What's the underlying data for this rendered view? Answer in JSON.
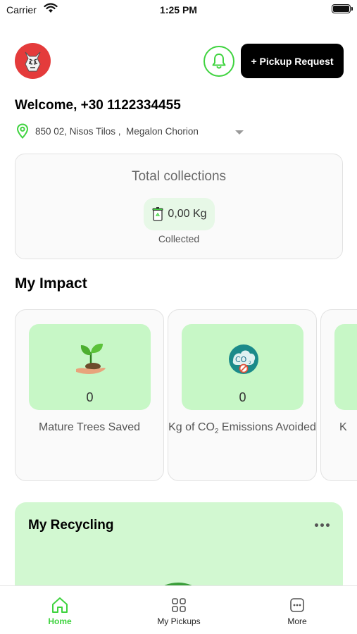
{
  "status_bar": {
    "carrier": "Carrier",
    "time": "1:25 PM"
  },
  "header": {
    "pickup_button_label": "+ Pickup Request"
  },
  "welcome_text": "Welcome, +30 1122334455",
  "location": "850 02, Nisos Tilos ,  Megalon Chorion",
  "total_collections": {
    "title": "Total collections",
    "amount": "0,00 Kg",
    "caption": "Collected"
  },
  "impact": {
    "title": "My Impact",
    "cards": [
      {
        "value": "0",
        "label": "Mature Trees Saved",
        "icon": "plant-icon"
      },
      {
        "value": "0",
        "label_prefix": "Kg of CO",
        "label_sub": "2",
        "label_suffix": " Emissions Avoided",
        "icon": "co2-icon"
      },
      {
        "value": "",
        "label": "K",
        "icon": ""
      }
    ]
  },
  "recycling": {
    "title": "My Recycling"
  },
  "bottom_nav": {
    "items": [
      {
        "label": "Home",
        "icon": "home-icon",
        "active": true
      },
      {
        "label": "My Pickups",
        "icon": "grid-icon",
        "active": false
      },
      {
        "label": "More",
        "icon": "more-icon",
        "active": false
      }
    ]
  },
  "colors": {
    "accent": "#3fd33f",
    "impact_tile": "#c7f7c6",
    "recycling_card": "#d2f8d1",
    "avatar": "#e43b3b"
  }
}
